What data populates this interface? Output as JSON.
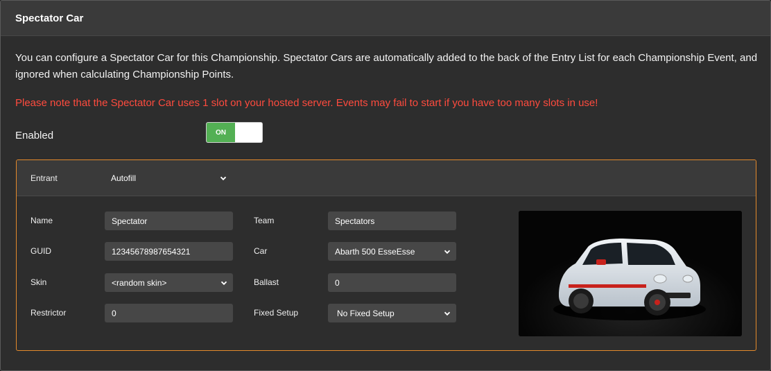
{
  "panel": {
    "title": "Spectator Car",
    "intro": "You can configure a Spectator Car for this Championship. Spectator Cars are automatically added to the back of the Entry List for each Championship Event, and ignored when calculating Championship Points.",
    "warning": "Please note that the Spectator Car uses 1 slot on your hosted server. Events may fail to start if you have too many slots in use!",
    "enabled_label": "Enabled",
    "toggle_label": "ON",
    "toggle_state": true
  },
  "entrant": {
    "label": "Entrant",
    "value": "Autofill"
  },
  "fields": {
    "name_label": "Name",
    "name_value": "Spectator",
    "guid_label": "GUID",
    "guid_value": "12345678987654321",
    "skin_label": "Skin",
    "skin_value": "<random skin>",
    "restrictor_label": "Restrictor",
    "restrictor_value": "0",
    "team_label": "Team",
    "team_value": "Spectators",
    "car_label": "Car",
    "car_value": "Abarth 500 EsseEsse",
    "ballast_label": "Ballast",
    "ballast_value": "0",
    "fixed_setup_label": "Fixed Setup",
    "fixed_setup_value": "No Fixed Setup"
  },
  "colors": {
    "accent_orange": "#e58a2b",
    "warning_red": "#ff4b3e",
    "toggle_green": "#53b054"
  },
  "icons": {
    "select_arrow": "chevron-down-icon",
    "car_preview": "car-preview-image"
  }
}
